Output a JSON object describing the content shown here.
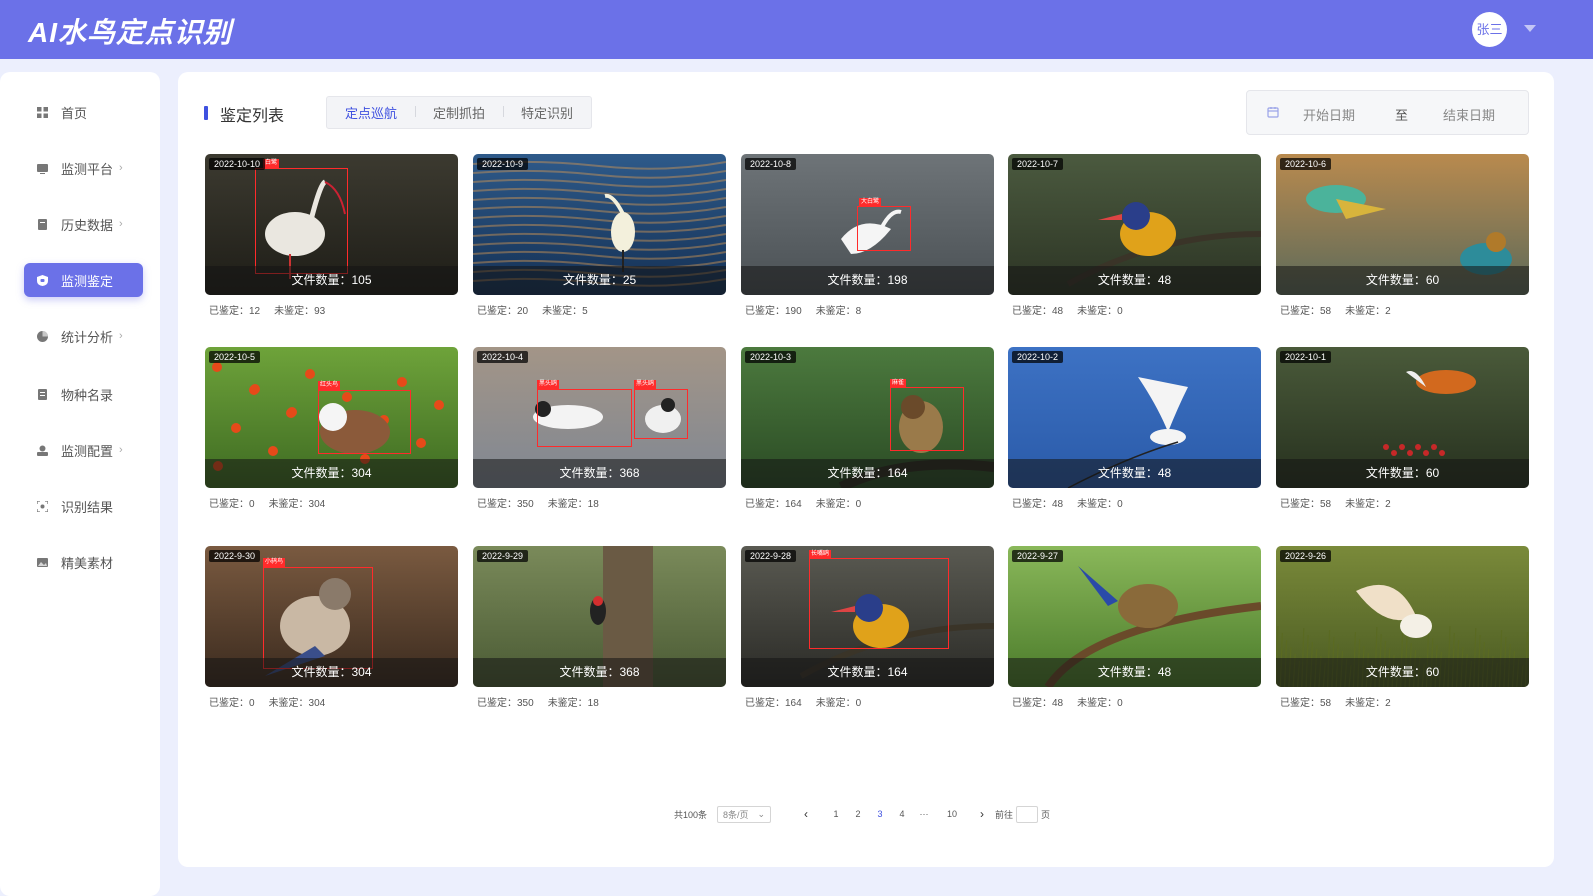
{
  "app": {
    "title": "AI水鸟定点识别"
  },
  "user": {
    "name": "张三"
  },
  "sidebar": {
    "items": [
      {
        "label": "首页",
        "arrow": ""
      },
      {
        "label": "监测平台",
        "arrow": "›"
      },
      {
        "label": "历史数据",
        "arrow": "›"
      },
      {
        "label": "监测鉴定",
        "arrow": ""
      },
      {
        "label": "统计分析",
        "arrow": "›"
      },
      {
        "label": "物种名录",
        "arrow": ""
      },
      {
        "label": "监测配置",
        "arrow": "›"
      },
      {
        "label": "识别结果",
        "arrow": ""
      },
      {
        "label": "精美素材",
        "arrow": ""
      }
    ],
    "active_index": 3
  },
  "main": {
    "section_title": "鉴定列表",
    "tabs": [
      "定点巡航",
      "定制抓拍",
      "特定识别"
    ],
    "active_tab": 0,
    "date_range": {
      "start": "开始日期",
      "separator": "至",
      "end": "结束日期"
    }
  },
  "cards": [
    {
      "date": "2022-10-10",
      "file_count": "文件数量：105",
      "verified": "已鉴定：12",
      "unverified": "未鉴定：93",
      "detection": "白鹭",
      "scene": "ibis"
    },
    {
      "date": "2022-10-9",
      "file_count": "文件数量：25",
      "verified": "已鉴定：20",
      "unverified": "未鉴定：5",
      "detection": "",
      "scene": "egret-water"
    },
    {
      "date": "2022-10-8",
      "file_count": "文件数量：198",
      "verified": "已鉴定：190",
      "unverified": "未鉴定：8",
      "detection": "大白鹭",
      "scene": "egret-gray"
    },
    {
      "date": "2022-10-7",
      "file_count": "文件数量：48",
      "verified": "已鉴定：48",
      "unverified": "未鉴定：0",
      "detection": "",
      "scene": "kingfisher"
    },
    {
      "date": "2022-10-6",
      "file_count": "文件数量：60",
      "verified": "已鉴定：58",
      "unverified": "未鉴定：2",
      "detection": "",
      "scene": "bee-eater"
    },
    {
      "date": "2022-10-5",
      "file_count": "文件数量：304",
      "verified": "已鉴定：0",
      "unverified": "未鉴定：304",
      "detection": "红头鸟",
      "scene": "berries"
    },
    {
      "date": "2022-10-4",
      "file_count": "文件数量：368",
      "verified": "已鉴定：350",
      "unverified": "未鉴定：18",
      "detection": "黑头鸥",
      "scene": "terns"
    },
    {
      "date": "2022-10-3",
      "file_count": "文件数量：164",
      "verified": "已鉴定：164",
      "unverified": "未鉴定：0",
      "detection": "麻雀",
      "scene": "sparrow"
    },
    {
      "date": "2022-10-2",
      "file_count": "文件数量：48",
      "verified": "已鉴定：48",
      "unverified": "未鉴定：0",
      "detection": "",
      "scene": "sky"
    },
    {
      "date": "2022-10-1",
      "file_count": "文件数量：60",
      "verified": "已鉴定：58",
      "unverified": "未鉴定：2",
      "detection": "",
      "scene": "redstart"
    },
    {
      "date": "2022-9-30",
      "file_count": "文件数量：304",
      "verified": "已鉴定：0",
      "unverified": "未鉴定：304",
      "detection": "小鸫鸟",
      "scene": "thrush"
    },
    {
      "date": "2022-9-29",
      "file_count": "文件数量：368",
      "verified": "已鉴定：350",
      "unverified": "未鉴定：18",
      "detection": "",
      "scene": "woodpecker"
    },
    {
      "date": "2022-9-28",
      "file_count": "文件数量：164",
      "verified": "已鉴定：164",
      "unverified": "未鉴定：0",
      "detection": "长嘴鸥",
      "scene": "kingfisher2"
    },
    {
      "date": "2022-9-27",
      "file_count": "文件数量：48",
      "verified": "已鉴定：48",
      "unverified": "未鉴定：0",
      "detection": "",
      "scene": "bird-branch"
    },
    {
      "date": "2022-9-26",
      "file_count": "文件数量：60",
      "verified": "已鉴定：58",
      "unverified": "未鉴定：2",
      "detection": "",
      "scene": "egret-grass"
    }
  ],
  "pagination": {
    "total": "共100条",
    "page_size": "8条/页",
    "pages": [
      "1",
      "2",
      "3",
      "4",
      "···",
      "10"
    ],
    "current_index": 2,
    "goto_prefix": "前往",
    "goto_suffix": "页"
  }
}
